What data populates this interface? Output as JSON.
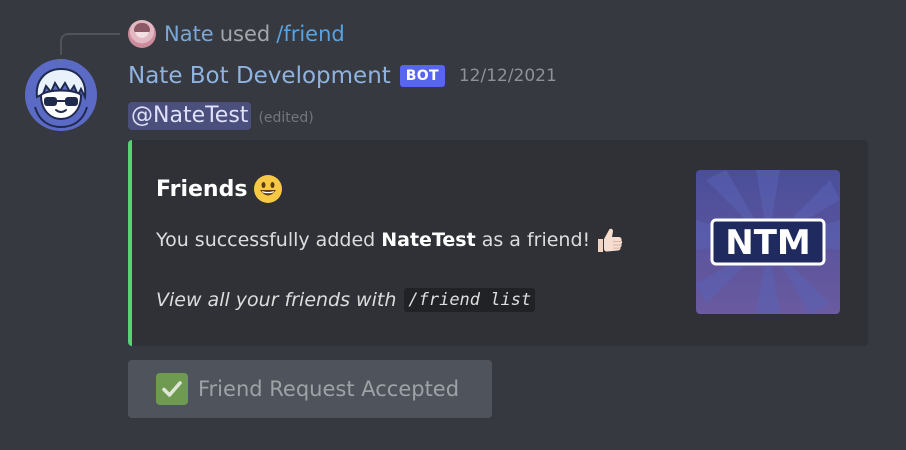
{
  "reply": {
    "user": "Nate",
    "used": "used",
    "command": "/friend"
  },
  "message": {
    "author": "Nate Bot Development",
    "bot_tag": "BOT",
    "timestamp": "12/12/2021",
    "mention": "@NateTest",
    "edited": "(edited)"
  },
  "embed": {
    "accent_color": "#57d276",
    "title": "Friends",
    "title_emoji": "grinning-face-icon",
    "description_prefix": "You successfully added ",
    "description_name": "NateTest",
    "description_suffix": " as a friend!",
    "description_emoji": "thumbs-up-icon",
    "footer_text": "View all your friends with",
    "footer_code": "/friend list",
    "thumbnail_text": "NTM"
  },
  "button": {
    "label": "Friend Request Accepted",
    "icon": "check-mark-icon",
    "disabled": true
  },
  "colors": {
    "background": "#36393f",
    "embed_bg": "#2f3136",
    "bot_tag": "#5865f2",
    "author_name": "#8fb3e0"
  }
}
